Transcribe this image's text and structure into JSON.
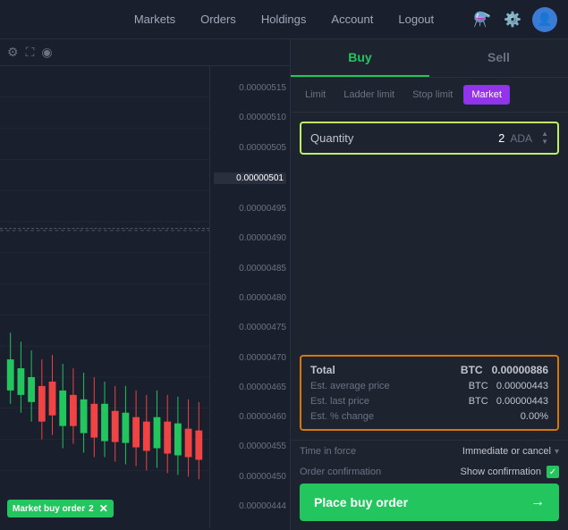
{
  "nav": {
    "links": [
      "Markets",
      "Orders",
      "Holdings",
      "Account",
      "Logout"
    ],
    "icons": [
      "flask",
      "settings",
      "user"
    ]
  },
  "chart": {
    "toolbar_icons": [
      "settings",
      "expand",
      "eye"
    ],
    "prices": [
      "0.00000515",
      "0.00000510",
      "0.00000505",
      "0.00000501",
      "0.00000495",
      "0.00000490",
      "0.00000485",
      "0.00000480",
      "0.00000475",
      "0.00000470",
      "0.00000465",
      "0.00000460",
      "0.00000455",
      "0.00000450",
      "0.00000444"
    ],
    "current_price": "0.00000501",
    "market_order_label": "Market buy order",
    "market_order_qty": "2"
  },
  "right_panel": {
    "buy_tab": "Buy",
    "sell_tab": "Sell",
    "order_types": [
      "Limit",
      "Ladder limit",
      "Stop limit",
      "Market"
    ],
    "active_order_type": "Market",
    "quantity_label": "Quantity",
    "quantity_value": "2",
    "quantity_currency": "ADA",
    "summary": {
      "total_label": "Total",
      "total_currency": "BTC",
      "total_value": "0.00000886",
      "avg_price_label": "Est. average price",
      "avg_price_currency": "BTC",
      "avg_price_value": "0.00000443",
      "last_price_label": "Est. last price",
      "last_price_currency": "BTC",
      "last_price_value": "0.00000443",
      "pct_change_label": "Est. % change",
      "pct_change_value": "0.00%"
    },
    "time_in_force_label": "Time in force",
    "time_in_force_value": "Immediate or cancel",
    "order_confirmation_label": "Order confirmation",
    "order_confirmation_value": "Show confirmation",
    "place_order_btn": "Place buy order"
  }
}
